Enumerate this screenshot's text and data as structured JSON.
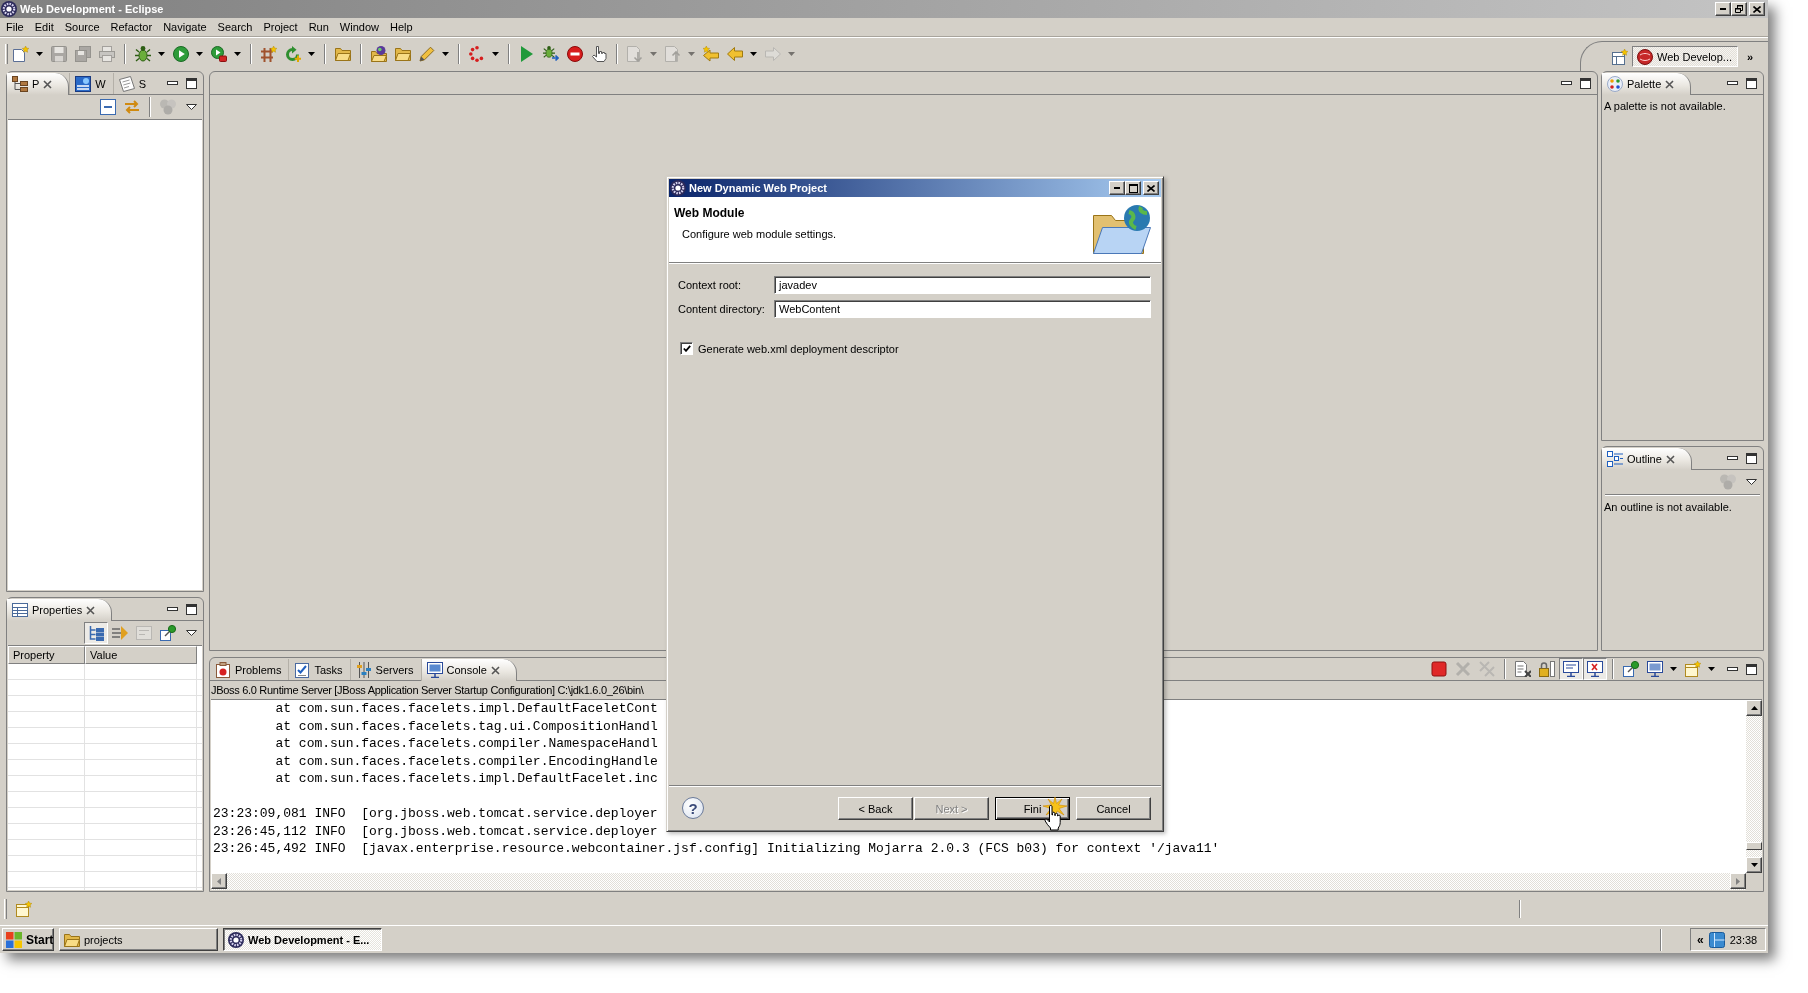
{
  "window": {
    "title": "Web Development - Eclipse"
  },
  "menu": [
    "File",
    "Edit",
    "Source",
    "Refactor",
    "Navigate",
    "Search",
    "Project",
    "Run",
    "Window",
    "Help"
  ],
  "toolbar": [
    [
      {
        "kind": "new",
        "dropdown": true,
        "disabled": false
      },
      {
        "kind": "save",
        "dropdown": false,
        "disabled": true
      },
      {
        "kind": "save_all",
        "dropdown": false,
        "disabled": true
      },
      {
        "kind": "print",
        "dropdown": false,
        "disabled": true
      }
    ],
    [
      {
        "kind": "debug",
        "dropdown": true,
        "disabled": false
      },
      {
        "kind": "run",
        "dropdown": true,
        "disabled": false
      },
      {
        "kind": "external_tools",
        "dropdown": true,
        "disabled": false
      }
    ],
    [
      {
        "kind": "new_server",
        "dropdown": false,
        "disabled": false
      },
      {
        "kind": "new_class",
        "dropdown": true,
        "disabled": false
      }
    ],
    [
      {
        "kind": "open_type",
        "dropdown": false,
        "disabled": false
      }
    ],
    [
      {
        "kind": "open_web",
        "dropdown": false,
        "disabled": false
      },
      {
        "kind": "open_folder",
        "dropdown": false,
        "disabled": false
      },
      {
        "kind": "pencil",
        "dropdown": true,
        "disabled": false
      }
    ],
    [
      {
        "kind": "spinner",
        "dropdown": true,
        "disabled": false
      }
    ],
    [
      {
        "kind": "play",
        "dropdown": false,
        "disabled": false
      },
      {
        "kind": "debug_server",
        "dropdown": false,
        "disabled": false
      },
      {
        "kind": "stop_server",
        "dropdown": false,
        "disabled": false
      },
      {
        "kind": "hand",
        "dropdown": false,
        "disabled": false
      }
    ],
    [
      {
        "kind": "next_annotation",
        "dropdown": true,
        "disabled": true
      },
      {
        "kind": "prev_annotation",
        "dropdown": true,
        "disabled": true
      },
      {
        "kind": "last_edit",
        "dropdown": false,
        "disabled": false
      },
      {
        "kind": "back",
        "dropdown": true,
        "disabled": false
      },
      {
        "kind": "forward",
        "dropdown": true,
        "disabled": true
      }
    ]
  ],
  "perspective_bar": {
    "perspective": {
      "label": "Web Develop...",
      "selected": true
    },
    "more": "»"
  },
  "navigator": {
    "tabs": [
      {
        "label": "P",
        "kind": "package",
        "selected": true
      },
      {
        "label": "W",
        "kind": "web",
        "selected": false
      },
      {
        "label": "S",
        "kind": "snippets",
        "selected": false
      }
    ],
    "toolbar": [
      [
        {
          "kind": "collapse_all",
          "disabled": false
        },
        {
          "kind": "link_editor",
          "disabled": false
        }
      ],
      [
        {
          "kind": "filter_circles",
          "disabled": true
        }
      ]
    ]
  },
  "properties": {
    "tab": {
      "label": "Properties",
      "kind": "properties",
      "selected": true
    },
    "toolbar": [
      [
        {
          "kind": "categories",
          "pressed": true,
          "disabled": false
        },
        {
          "kind": "advanced",
          "pressed": false,
          "disabled": false
        },
        {
          "kind": "filter_page",
          "disabled": true
        },
        {
          "kind": "pin",
          "disabled": false
        }
      ]
    ],
    "columns": [
      "Property",
      "Value"
    ]
  },
  "palette": {
    "tab": {
      "label": "Palette",
      "kind": "palette",
      "selected": true
    },
    "message": "A palette is not available."
  },
  "outline": {
    "tab": {
      "label": "Outline",
      "kind": "outline",
      "selected": true
    },
    "toolbar": [
      [
        {
          "kind": "filter_circles",
          "disabled": true
        }
      ]
    ],
    "message": "An outline is not available."
  },
  "console": {
    "tabs": [
      {
        "label": "Problems",
        "kind": "problems",
        "selected": false
      },
      {
        "label": "Tasks",
        "kind": "tasks",
        "selected": false
      },
      {
        "label": "Servers",
        "kind": "servers",
        "selected": false
      },
      {
        "label": "Console",
        "kind": "console",
        "selected": true
      }
    ],
    "toolbar": [
      [
        {
          "kind": "terminate",
          "disabled": false
        },
        {
          "kind": "remove_launch",
          "disabled": true
        },
        {
          "kind": "remove_all",
          "disabled": true
        }
      ],
      [
        {
          "kind": "clear",
          "disabled": false
        },
        {
          "kind": "scroll_lock",
          "disabled": false
        },
        {
          "kind": "show_on_out",
          "pressed": true,
          "disabled": false
        },
        {
          "kind": "show_on_err",
          "pressed": true,
          "disabled": false
        }
      ],
      [
        {
          "kind": "pin",
          "disabled": false
        },
        {
          "kind": "display",
          "dropdown": true,
          "disabled": false
        },
        {
          "kind": "open_console",
          "dropdown": true,
          "disabled": false
        }
      ]
    ],
    "header": "JBoss 6.0 Runtime Server [JBoss Application Server Startup Configuration] C:\\jdk1.6.0_26\\bin\\",
    "line_groups": [
      [
        "\tat com.sun.faces.facelets.impl.DefaultFaceletCont",
        "\tat com.sun.faces.facelets.tag.ui.CompositionHandl",
        "\tat com.sun.faces.facelets.compiler.NamespaceHandl",
        "\tat com.sun.faces.facelets.compiler.EncodingHandle",
        "\tat com.sun.faces.facelets.impl.DefaultFacelet.inc"
      ],
      [
        "23:23:09,081 INFO  [org.jboss.web.tomcat.service.deployer",
        "23:26:45,112 INFO  [org.jboss.web.tomcat.service.deployer",
        "23:26:45,492 INFO  [javax.enterprise.resource.webcontainer.jsf.config] Initializing Mojarra 2.0.3 (FCS b03) for context '/java11'"
      ]
    ]
  },
  "dialog": {
    "title": "New Dynamic Web Project",
    "heading": "Web Module",
    "description": "Configure web module settings.",
    "fields": [
      {
        "label": "Context root:",
        "value": "javadev"
      },
      {
        "label": "Content directory:",
        "value": "WebContent"
      }
    ],
    "checkbox": {
      "label": "Generate web.xml deployment descriptor",
      "checked": true
    },
    "help": "?",
    "buttons": [
      {
        "label": "< Back",
        "disabled": false,
        "default": false
      },
      {
        "label": "Next >",
        "disabled": true,
        "default": false
      },
      {
        "label": "Fini",
        "disabled": false,
        "default": true
      },
      {
        "label": "Cancel",
        "disabled": false,
        "default": false
      }
    ]
  },
  "taskbar": {
    "start": "Start",
    "tasks": [
      {
        "label": "projects",
        "kind": "folder",
        "selected": false
      },
      {
        "label": "Web Development - E...",
        "kind": "app",
        "selected": true
      }
    ],
    "tray_toggle": "«",
    "clock": "23:38"
  }
}
